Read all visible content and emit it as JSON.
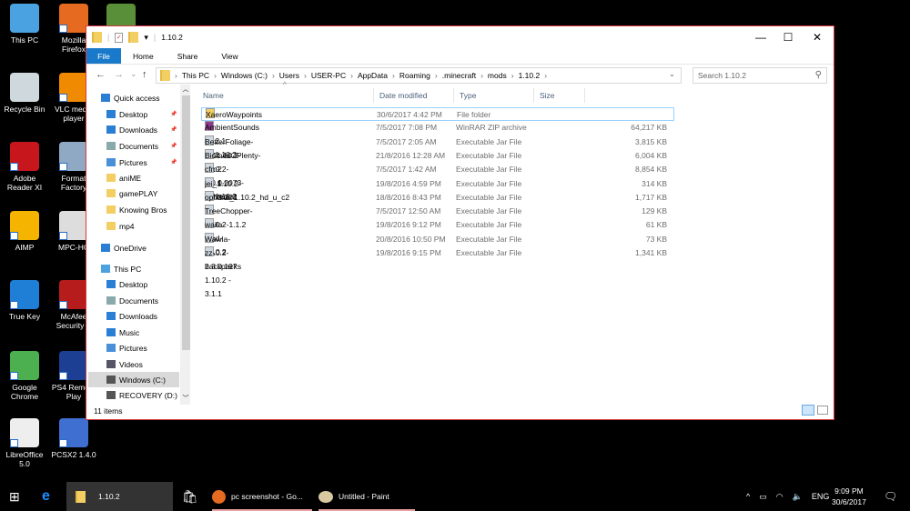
{
  "desktop_icons": [
    {
      "label": "This PC",
      "color": "#4aa3e0"
    },
    {
      "label": "Mozilla Firefox",
      "color": "#e66a1f"
    },
    {
      "label": "",
      "color": "#5a8f3a"
    },
    {
      "label": "Recycle Bin",
      "color": "#cfd8dc"
    },
    {
      "label": "VLC media player",
      "color": "#f08a00"
    },
    {
      "label": "Adobe Reader XI",
      "color": "#c8161d"
    },
    {
      "label": "Format Factory",
      "color": "#8fa9c4"
    },
    {
      "label": "AIMP",
      "color": "#f5b400"
    },
    {
      "label": "MPC-HC",
      "color": "#ddd"
    },
    {
      "label": "True Key",
      "color": "#1f7fd6"
    },
    {
      "label": "McAfee Security S",
      "color": "#b71c1c"
    },
    {
      "label": "Google Chrome",
      "color": "#4caf50"
    },
    {
      "label": "PS4 Remote Play",
      "color": "#1c3f94"
    },
    {
      "label": "LibreOffice 5.0",
      "color": "#eeeeee"
    },
    {
      "label": "PCSX2 1.4.0",
      "color": "#3f6fd0"
    }
  ],
  "window": {
    "title": "1.10.2",
    "controls": {
      "minimize": "—",
      "maximize": "☐",
      "close": "✕"
    },
    "ribbon_tabs": [
      "File",
      "Home",
      "Share",
      "View"
    ],
    "nav": {
      "back": "←",
      "forward": "→",
      "recent": "⌄",
      "up": "↑"
    },
    "breadcrumb": [
      "This PC",
      "Windows (C:)",
      "Users",
      "USER-PC",
      "AppData",
      "Roaming",
      ".minecraft",
      "mods",
      "1.10.2"
    ],
    "search_placeholder": "Search 1.10.2",
    "nav_pane": [
      {
        "label": "Quick access",
        "icon": "star-icon",
        "pinned": false
      },
      {
        "label": "Desktop",
        "icon": "desktop-icon",
        "pinned": true
      },
      {
        "label": "Downloads",
        "icon": "download-icon",
        "pinned": true
      },
      {
        "label": "Documents",
        "icon": "documents-icon",
        "pinned": true
      },
      {
        "label": "Pictures",
        "icon": "pictures-icon",
        "pinned": true
      },
      {
        "label": "aniME",
        "icon": "folder-icon",
        "pinned": false
      },
      {
        "label": "gamePLAY",
        "icon": "folder-icon",
        "pinned": false
      },
      {
        "label": "Knowing Bros",
        "icon": "folder-icon",
        "pinned": false
      },
      {
        "label": "mp4",
        "icon": "folder-icon",
        "pinned": false
      },
      {
        "label": "OneDrive",
        "icon": "cloud-icon",
        "pinned": false
      },
      {
        "label": "This PC",
        "icon": "computer-icon",
        "pinned": false
      },
      {
        "label": "Desktop",
        "icon": "desktop-icon",
        "pinned": false
      },
      {
        "label": "Documents",
        "icon": "documents-icon",
        "pinned": false
      },
      {
        "label": "Downloads",
        "icon": "download-icon",
        "pinned": false
      },
      {
        "label": "Music",
        "icon": "music-icon",
        "pinned": false
      },
      {
        "label": "Pictures",
        "icon": "pictures-icon",
        "pinned": false
      },
      {
        "label": "Videos",
        "icon": "videos-icon",
        "pinned": false
      },
      {
        "label": "Windows (C:)",
        "icon": "drive-icon",
        "pinned": false,
        "selected": true
      },
      {
        "label": "RECOVERY (D:)",
        "icon": "drive-icon",
        "pinned": false
      }
    ],
    "columns": [
      "Name",
      "Date modified",
      "Type",
      "Size"
    ],
    "files": [
      {
        "name": "XaeroWaypoints",
        "date": "30/6/2017 4:42 PM",
        "type": "File folder",
        "size": "",
        "icon": "folder"
      },
      {
        "name": "AmbientSounds v1.2.1 mc1.10.2",
        "date": "7/5/2017 7:08 PM",
        "type": "WinRAR ZIP archive",
        "size": "64,217 KB",
        "icon": "winrar"
      },
      {
        "name": "BetterFoliage-MC1.10.2-2.1.2",
        "date": "7/5/2017 2:05 AM",
        "type": "Executable Jar File",
        "size": "3,815 KB",
        "icon": "jar"
      },
      {
        "name": "BiomesOPlenty-1.10.2-5.0.0.2073-universal",
        "date": "21/8/2016 12:28 AM",
        "type": "Executable Jar File",
        "size": "6,004 KB",
        "icon": "jar"
      },
      {
        "name": "cfm-4.1.1-mc1.10.2",
        "date": "7/5/2017 1:42 AM",
        "type": "Executable Jar File",
        "size": "8,854 KB",
        "icon": "jar"
      },
      {
        "name": "jei_1.10.2-3.7.3.221",
        "date": "19/8/2016 4:59 PM",
        "type": "Executable Jar File",
        "size": "314 KB",
        "icon": "jar"
      },
      {
        "name": "optifine_1.10.2_hd_u_c2",
        "date": "18/8/2016 8:43 PM",
        "type": "Executable Jar File",
        "size": "1,717 KB",
        "icon": "jar"
      },
      {
        "name": "TreeChopper-1.10.2-1.1.2",
        "date": "7/5/2017 12:50 AM",
        "type": "Executable Jar File",
        "size": "129 KB",
        "icon": "jar"
      },
      {
        "name": "waila-mod-1.10.2",
        "date": "19/8/2016 9:12 PM",
        "type": "Executable Jar File",
        "size": "61 KB",
        "icon": "jar"
      },
      {
        "name": "Wawla-1.10.2-2.3.0.197",
        "date": "20/8/2016 10:50 PM",
        "type": "Executable Jar File",
        "size": "73 KB",
        "icon": "jar"
      },
      {
        "name": "zz-backpacks 1.10.2 - 3.1.1",
        "date": "19/8/2016 9:15 PM",
        "type": "Executable Jar File",
        "size": "1,341 KB",
        "icon": "jar"
      }
    ],
    "status": "11 items"
  },
  "taskbar": {
    "apps": [
      {
        "label": "1.10.2",
        "active": true
      },
      {
        "label": "pc screenshot - Go..."
      },
      {
        "label": "Untitled - Paint"
      }
    ],
    "lang": "ENG",
    "time": "9:09 PM",
    "date": "30/6/2017"
  },
  "colors": {
    "accent": "#1979ca",
    "window_border": "#d9373f",
    "selection": "#99d1ff"
  }
}
